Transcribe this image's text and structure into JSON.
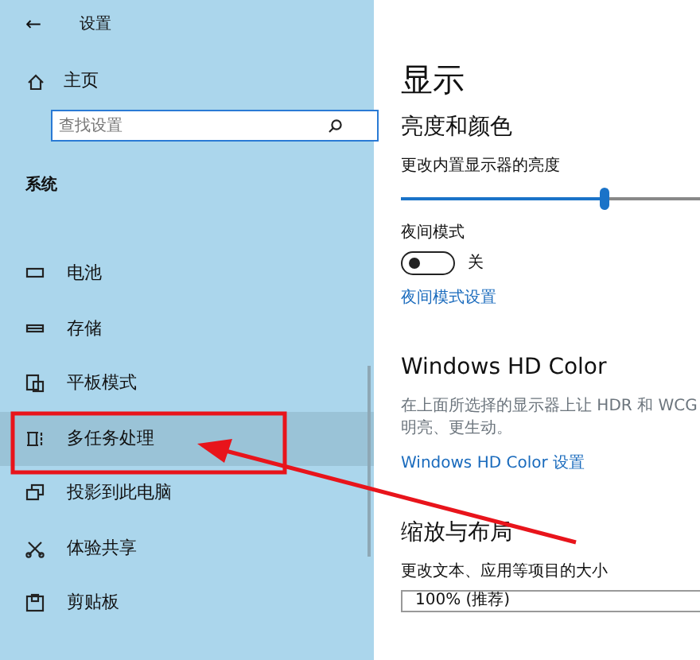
{
  "header": {
    "back": "←",
    "title": "设置"
  },
  "sidebar": {
    "home": "主页",
    "search": {
      "placeholder": "查找设置"
    },
    "section": "系统",
    "items": [
      {
        "label": "电池",
        "selected": false
      },
      {
        "label": "存储",
        "selected": false
      },
      {
        "label": "平板模式",
        "selected": false
      },
      {
        "label": "多任务处理",
        "selected": true
      },
      {
        "label": "投影到此电脑",
        "selected": false
      },
      {
        "label": "体验共享",
        "selected": false
      },
      {
        "label": "剪贴板",
        "selected": false
      }
    ]
  },
  "main": {
    "title": "显示",
    "brightness": {
      "heading": "亮度和颜色",
      "label": "更改内置显示器的亮度",
      "level": 0.64
    },
    "night": {
      "label": "夜间模式",
      "on": false,
      "state": "关",
      "link": "夜间模式设置"
    },
    "hd": {
      "heading": "Windows HD Color",
      "description": "在上面所选择的显示器上让 HDR 和 WCG",
      "description2": "明亮、更生动。",
      "link": "Windows HD Color 设置"
    },
    "scale": {
      "heading": "缩放与布局",
      "label": "更改文本、应用等项目的大小",
      "value": "100% (推荐)"
    }
  }
}
